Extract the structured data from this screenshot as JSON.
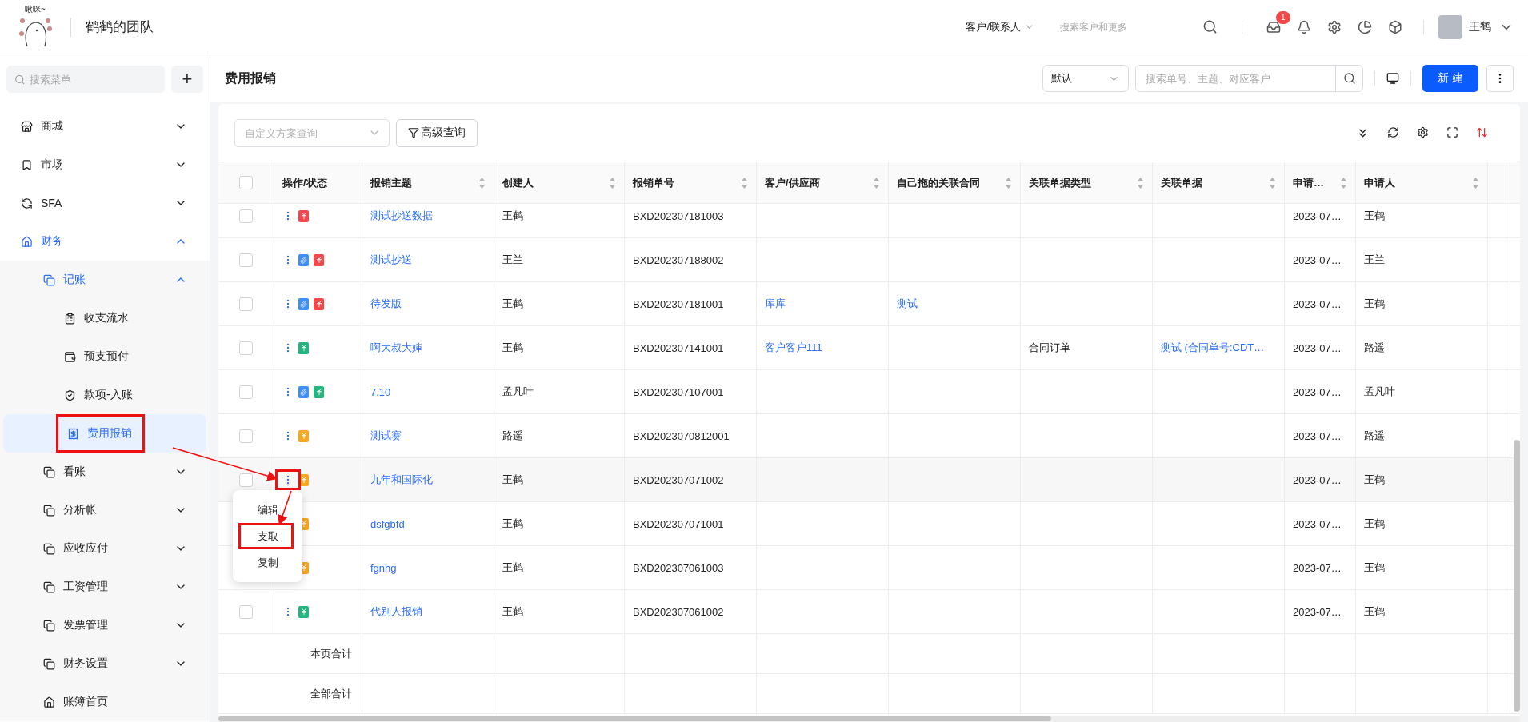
{
  "header": {
    "logo_text": "啾咪~",
    "team": "鹤鹤的团队",
    "scope": "客户/联系人",
    "search": {
      "placeholder": "搜索客户和更多"
    },
    "inbox_badge": "1",
    "user": "王鹤"
  },
  "sidebar": {
    "search": {
      "placeholder": "搜索菜单"
    },
    "add": "+",
    "items": [
      {
        "label": "商城",
        "expanded": false,
        "selected": false
      },
      {
        "label": "市场",
        "expanded": false,
        "selected": false
      },
      {
        "label": "SFA",
        "expanded": false,
        "selected": false
      },
      {
        "label": "财务",
        "expanded": true,
        "selected": false,
        "children": [
          {
            "label": "记账",
            "expanded": true,
            "selected": false,
            "children": [
              {
                "label": "收支流水",
                "selected": false,
                "annotated": false
              },
              {
                "label": "预支预付",
                "selected": false,
                "annotated": false
              },
              {
                "label": "款项-入账",
                "selected": false,
                "annotated": false
              },
              {
                "label": "费用报销",
                "selected": true,
                "annotated": true
              }
            ]
          },
          {
            "label": "看账",
            "expanded": false,
            "selected": false
          },
          {
            "label": "分析帐",
            "expanded": false,
            "selected": false
          },
          {
            "label": "应收应付",
            "expanded": false,
            "selected": false
          },
          {
            "label": "工资管理",
            "expanded": false,
            "selected": false
          },
          {
            "label": "发票管理",
            "expanded": false,
            "selected": false
          },
          {
            "label": "财务设置",
            "expanded": false,
            "selected": false
          },
          {
            "label": "账簿首页",
            "selected": false
          }
        ]
      }
    ]
  },
  "page": {
    "title": "费用报销",
    "view": "默认",
    "search": {
      "placeholder": "搜索单号、主题、对应客户"
    },
    "new_button": "新 建"
  },
  "filters": {
    "scheme": {
      "placeholder": "自定义方案查询"
    },
    "advanced": "高级查询"
  },
  "table": {
    "header_checked": false,
    "columns": [
      {
        "label": "操作/状态",
        "sortable": false
      },
      {
        "label": "报销主题",
        "sortable": true,
        "link": true
      },
      {
        "label": "创建人",
        "sortable": true,
        "link": false
      },
      {
        "label": "报销单号",
        "sortable": true,
        "link": false
      },
      {
        "label": "客户/供应商",
        "sortable": true,
        "link": true
      },
      {
        "label": "自己拖的关联合同",
        "sortable": true,
        "link": true
      },
      {
        "label": "关联单据类型",
        "sortable": true,
        "link": false
      },
      {
        "label": "关联单据",
        "sortable": true,
        "link": true
      },
      {
        "label": "申请…",
        "sortable": true,
        "link": false
      },
      {
        "label": "申请人",
        "sortable": true,
        "link": false
      }
    ],
    "rows": [
      {
        "checked": false,
        "menu_open": false,
        "annotated": false,
        "status": [
          {
            "kind": "yen",
            "color": "#f2484b"
          }
        ],
        "cells": {
          "subject": "测试抄送数据",
          "creator": "王鹤",
          "number": "BXD202307181003",
          "apply_date": "2023-07…",
          "applicant": "王鹤"
        }
      },
      {
        "checked": false,
        "menu_open": false,
        "annotated": false,
        "status": [
          {
            "kind": "file"
          },
          {
            "kind": "yen",
            "color": "#f2484b"
          }
        ],
        "cells": {
          "subject": "测试抄送",
          "creator": "王兰",
          "number": "BXD202307188002",
          "apply_date": "2023-07…",
          "applicant": "王兰"
        }
      },
      {
        "checked": false,
        "menu_open": false,
        "annotated": false,
        "status": [
          {
            "kind": "file"
          },
          {
            "kind": "yen",
            "color": "#f2484b"
          }
        ],
        "cells": {
          "subject": "待发版",
          "creator": "王鹤",
          "number": "BXD202307181001",
          "customer": "库库",
          "contract": "测试",
          "apply_date": "2023-07…",
          "applicant": "王鹤"
        }
      },
      {
        "checked": false,
        "menu_open": false,
        "annotated": false,
        "status": [
          {
            "kind": "yen",
            "color": "#24b47e"
          }
        ],
        "cells": {
          "subject": "啊大叔大婶",
          "creator": "王鹤",
          "number": "BXD202307141001",
          "customer": "客户客户111",
          "ref_type": "合同订单",
          "ref": "测试 (合同单号:CDT…",
          "apply_date": "2023-07…",
          "applicant": "路遥"
        }
      },
      {
        "checked": false,
        "menu_open": false,
        "annotated": false,
        "status": [
          {
            "kind": "file"
          },
          {
            "kind": "yen",
            "color": "#24b47e"
          }
        ],
        "cells": {
          "subject": "7.10",
          "creator": "孟凡叶",
          "number": "BXD202307107001",
          "apply_date": "2023-07…",
          "applicant": "孟凡叶"
        }
      },
      {
        "checked": false,
        "menu_open": false,
        "annotated": false,
        "status": [
          {
            "kind": "yen",
            "color": "#f7a820"
          }
        ],
        "cells": {
          "subject": "测试赛",
          "creator": "路遥",
          "number": "BXD2023070812001",
          "apply_date": "2023-07…",
          "applicant": "路遥"
        }
      },
      {
        "checked": false,
        "menu_open": true,
        "annotated": true,
        "status": [
          {
            "kind": "yen",
            "color": "#f7a820"
          }
        ],
        "cells": {
          "subject": "九年和国际化",
          "creator": "王鹤",
          "number": "BXD202307071002",
          "apply_date": "2023-07…",
          "applicant": "王鹤"
        }
      },
      {
        "menu_open": false,
        "annotated": false,
        "status": [
          {
            "kind": "yen",
            "color": "#f7a820"
          }
        ],
        "cells": {
          "subject": "dsfgbfd",
          "creator": "王鹤",
          "number": "BXD202307071001",
          "apply_date": "2023-07…",
          "applicant": "王鹤"
        }
      },
      {
        "menu_open": false,
        "annotated": false,
        "status": [
          {
            "kind": "yen",
            "color": "#f7a820"
          }
        ],
        "cells": {
          "subject": "fgnhg",
          "creator": "王鹤",
          "number": "BXD202307061003",
          "apply_date": "2023-07…",
          "applicant": "王鹤"
        }
      },
      {
        "checked": false,
        "menu_open": false,
        "annotated": false,
        "status": [
          {
            "kind": "yen",
            "color": "#24b47e"
          }
        ],
        "cells": {
          "subject": "代别人报销",
          "creator": "王鹤",
          "number": "BXD202307061002",
          "apply_date": "2023-07…",
          "applicant": "王鹤"
        }
      }
    ],
    "summary": [
      "本页合计",
      "全部合计"
    ]
  },
  "row_menu": {
    "items": [
      {
        "label": "编辑",
        "annotated": false
      },
      {
        "label": "支取",
        "annotated": true
      },
      {
        "label": "复制",
        "annotated": false
      }
    ]
  }
}
